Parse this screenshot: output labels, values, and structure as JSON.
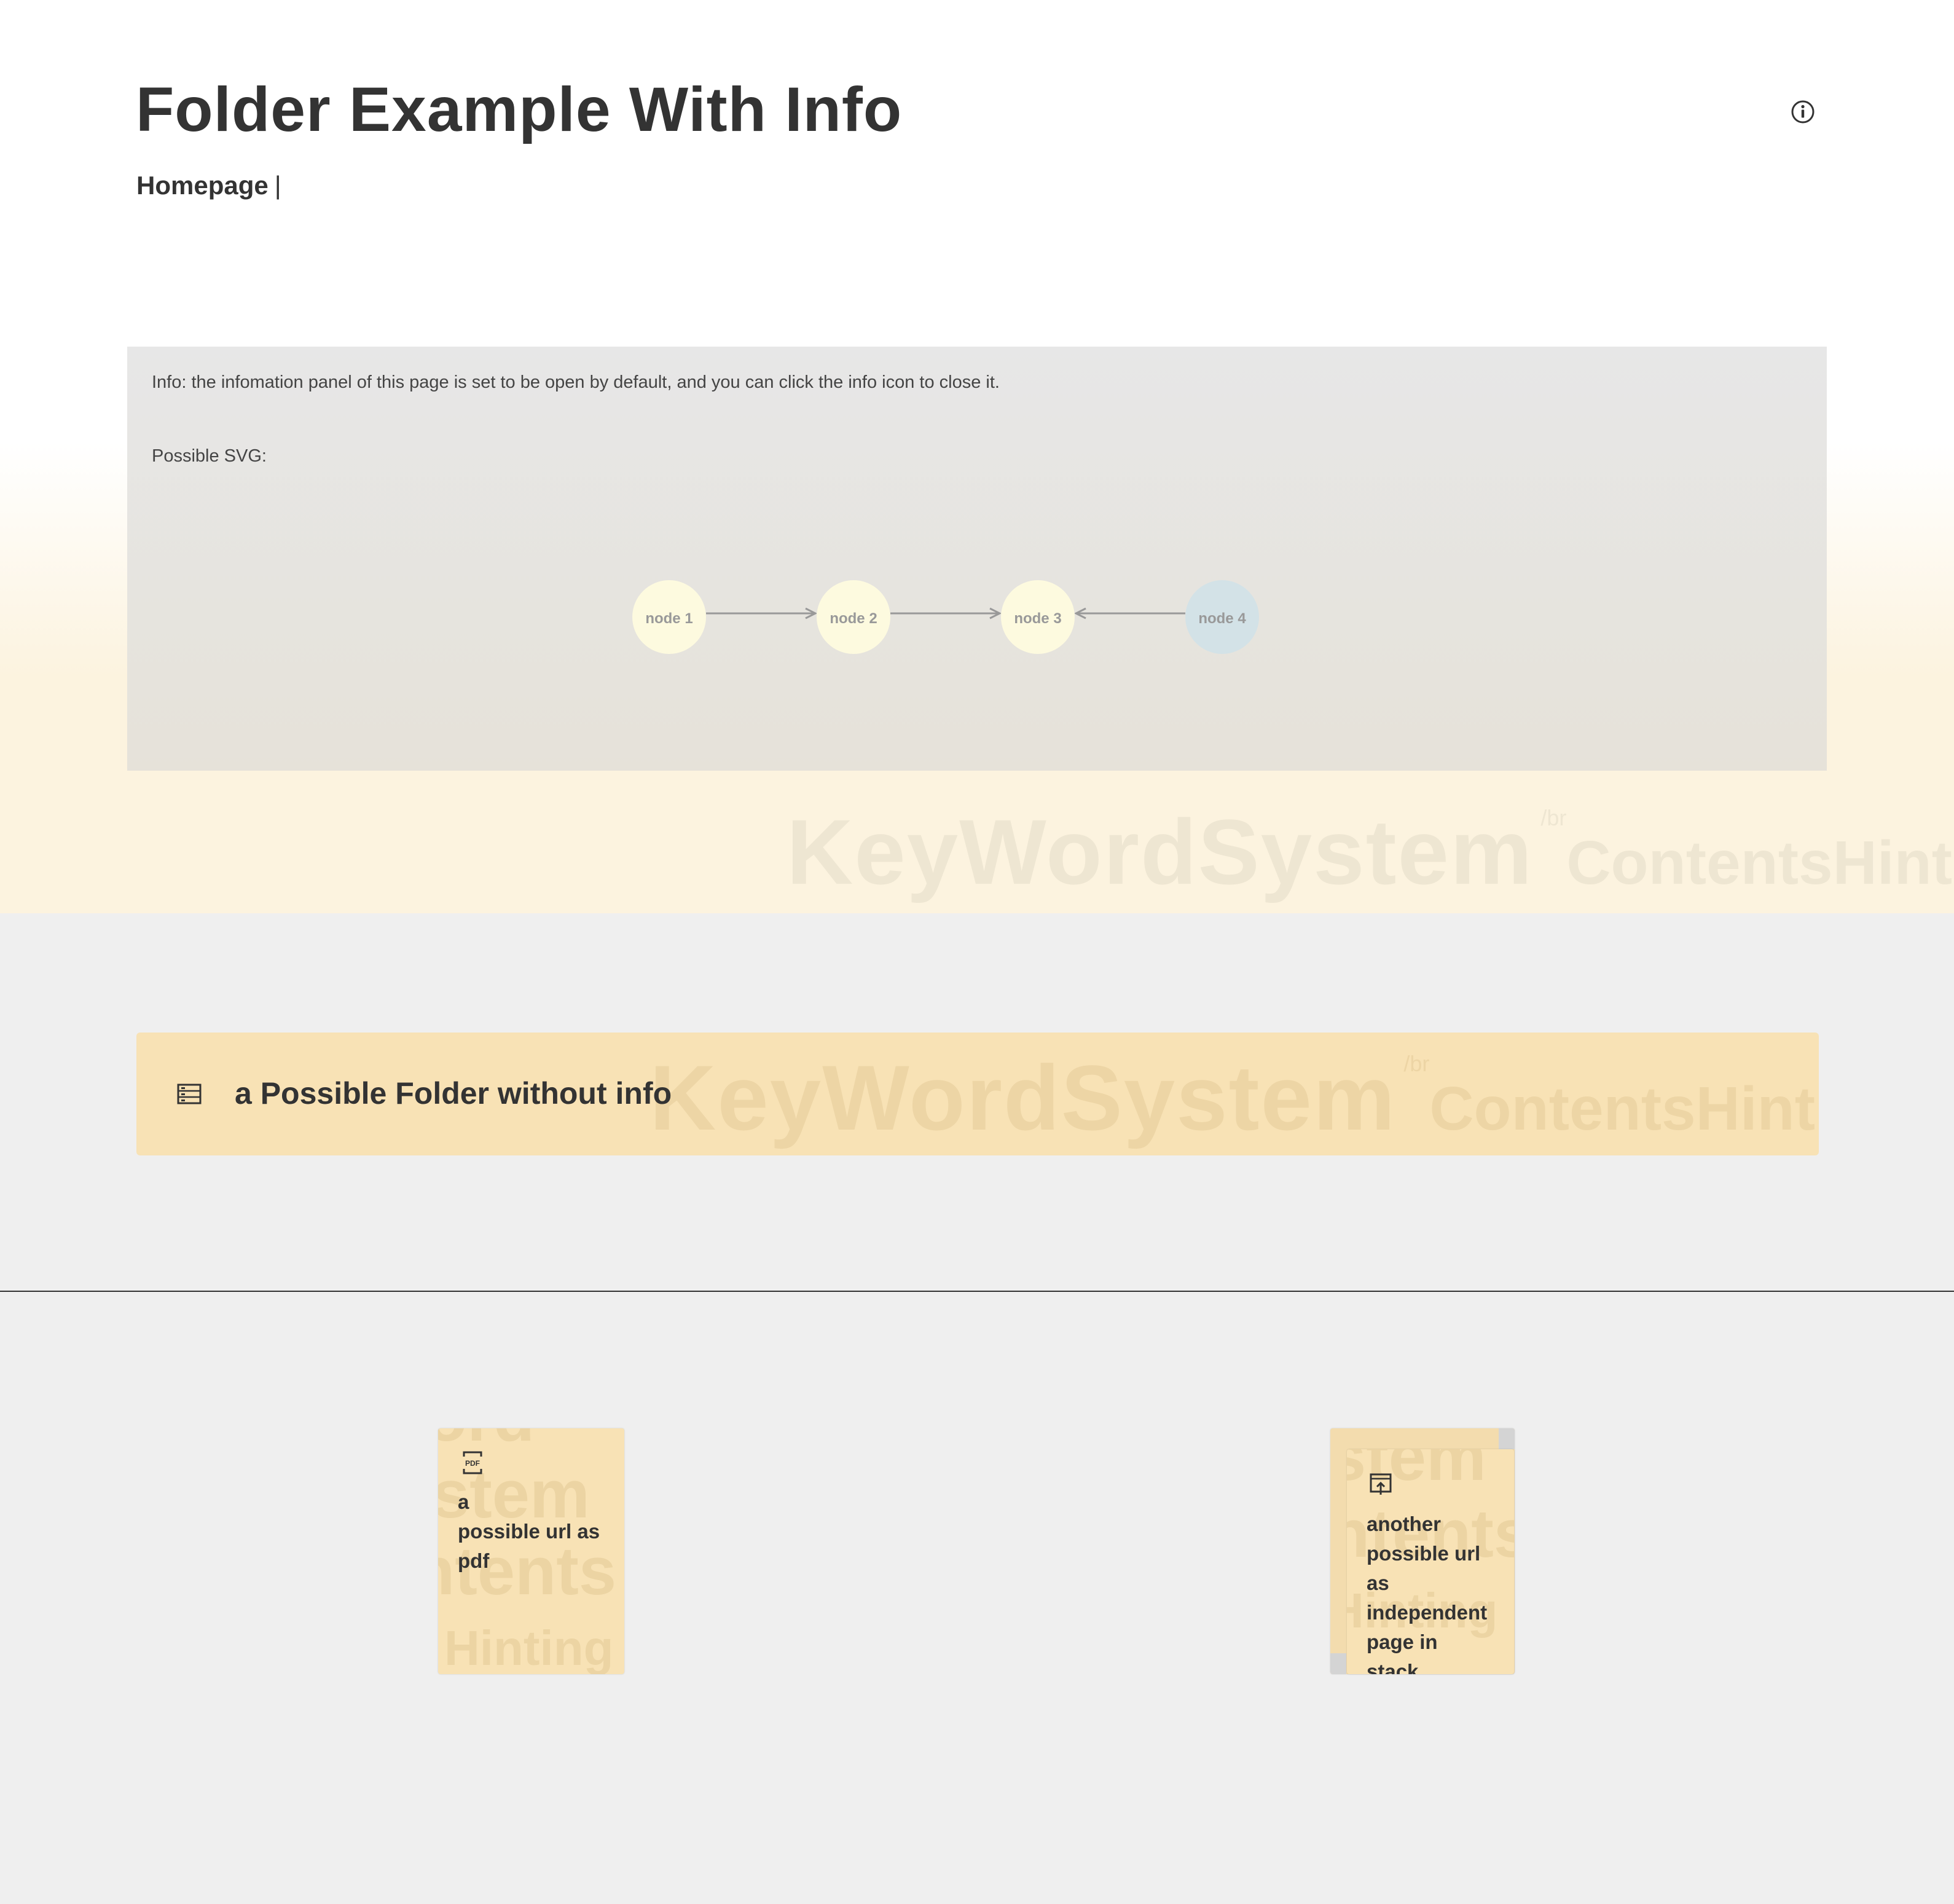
{
  "page": {
    "title": "Folder Example With Info",
    "breadcrumb": {
      "home": "Homepage",
      "separator": "|"
    }
  },
  "info_panel": {
    "text": "Info: the infomation panel of this page is set to be open by default, and you can click the info icon to close it.",
    "svg_label": "Possible SVG:",
    "diagram": {
      "nodes": [
        {
          "label": "node 1",
          "color": "#fdfadf"
        },
        {
          "label": "node 2",
          "color": "#fdfadf"
        },
        {
          "label": "node 3",
          "color": "#fdfadf"
        },
        {
          "label": "node 4",
          "color": "#d3e2e7"
        }
      ],
      "edges": [
        {
          "from": "node 1",
          "to": "node 2"
        },
        {
          "from": "node 2",
          "to": "node 3"
        },
        {
          "from": "node 4",
          "to": "node 3"
        }
      ]
    }
  },
  "watermark": {
    "keyword": "KeyWord",
    "system": "System",
    "br": "/br",
    "contents": "Contents",
    "hinting": "Hinting"
  },
  "folder": {
    "title": "a Possible Folder without info",
    "icon": "folder-list-icon"
  },
  "cards": [
    {
      "label_lines": [
        "a",
        "possible url as",
        "pdf"
      ],
      "icon": "pdf-icon"
    },
    {
      "label_lines": [
        "another",
        "possible url",
        "as",
        "independent",
        "page in",
        "stack"
      ],
      "icon": "page-stack-icon"
    }
  ],
  "colors": {
    "accent_card": "#f8e2b5",
    "panel": "#e7e7e7",
    "background": "#efefef"
  }
}
